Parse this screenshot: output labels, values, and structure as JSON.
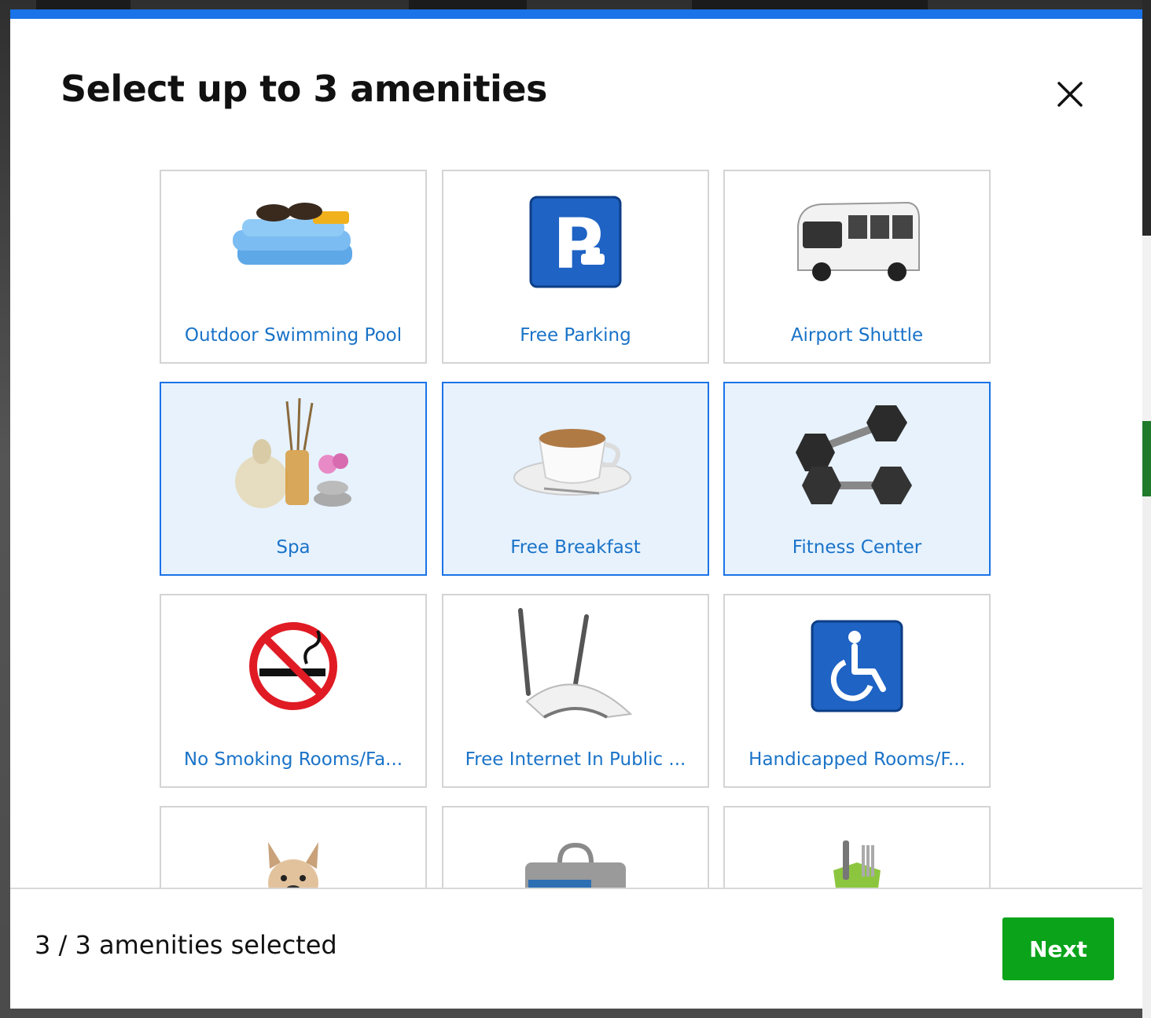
{
  "modal": {
    "title": "Select up to 3 amenities",
    "close_icon": "close-icon",
    "accent_color": "#1a73e8",
    "selected_background": "#e7f2fd"
  },
  "amenities": [
    {
      "label": "Outdoor Swimming Pool",
      "icon": "towel-sunglasses-image",
      "selected": false
    },
    {
      "label": "Free Parking",
      "icon": "parking-sign-image",
      "selected": false
    },
    {
      "label": "Airport Shuttle",
      "icon": "shuttle-bus-image",
      "selected": false
    },
    {
      "label": "Spa",
      "icon": "spa-image",
      "selected": true
    },
    {
      "label": "Free Breakfast",
      "icon": "coffee-cup-image",
      "selected": true
    },
    {
      "label": "Fitness Center",
      "icon": "dumbbells-image",
      "selected": true
    },
    {
      "label": "No Smoking Rooms/Fa...",
      "icon": "no-smoking-image",
      "selected": false
    },
    {
      "label": "Free Internet In Public ...",
      "icon": "wifi-router-image",
      "selected": false
    },
    {
      "label": "Handicapped Rooms/F...",
      "icon": "wheelchair-image",
      "selected": false
    },
    {
      "label": "",
      "icon": "dog-image",
      "selected": false
    },
    {
      "label": "",
      "icon": "laptop-bag-image",
      "selected": false
    },
    {
      "label": "",
      "icon": "cutlery-image",
      "selected": false
    }
  ],
  "footer": {
    "status": "3 / 3 amenities selected",
    "next_label": "Next",
    "next_color": "#0aa31a"
  }
}
